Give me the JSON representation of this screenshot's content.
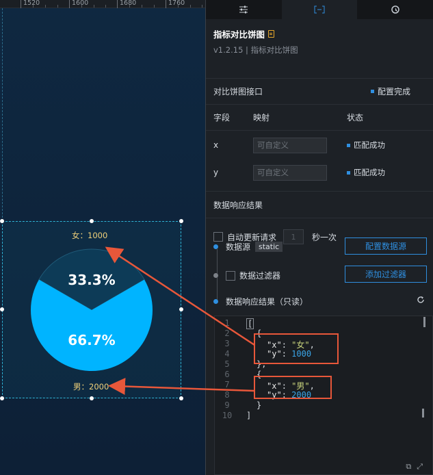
{
  "ruler": {
    "labels": [
      "1520",
      "1600",
      "1680",
      "1760"
    ]
  },
  "widget": {
    "top_label": "女：1000",
    "bottom_label": "男：2000",
    "pct_small": "33.3%",
    "pct_large": "66.7%",
    "colors": {
      "large_slice": "#00b4ff",
      "small_slice": "#0d3b57",
      "label": "#f2d27a"
    }
  },
  "chart_data": {
    "type": "pie",
    "categories": [
      "女",
      "男"
    ],
    "values": [
      1000,
      2000
    ]
  },
  "panel": {
    "tabs": [
      "settings-sliders-icon",
      "data-bracket-icon",
      "interaction-icon"
    ],
    "title": "指标对比饼图",
    "subtitle": "v1.2.15 | 指标对比饼图",
    "interface_label": "对比饼图接口",
    "config_done": "配置完成",
    "field_headers": {
      "field": "字段",
      "mapping": "映射",
      "status": "状态"
    },
    "fields": [
      {
        "name": "x",
        "placeholder": "可自定义",
        "status": "匹配成功"
      },
      {
        "name": "y",
        "placeholder": "可自定义",
        "status": "匹配成功"
      }
    ],
    "response_title": "数据响应结果",
    "auto_update": "自动更新请求",
    "interval_value": "1",
    "interval_unit": "秒一次",
    "datasource_label": "数据源",
    "datasource_tag": "static",
    "config_source_btn": "配置数据源",
    "filter_label": "数据过滤器",
    "add_filter_btn": "添加过滤器",
    "response_readonly": "数据响应结果（只读）",
    "code_lines": [
      "1",
      "2",
      "3",
      "4",
      "5",
      "6",
      "7",
      "8",
      "9",
      "10"
    ]
  },
  "code": {
    "open": "[",
    "brace_open": "{",
    "x_key": "\"x\"",
    "x1": "\"女\"",
    "y_key": "\"y\"",
    "y1": "1000",
    "brace_close_comma": "},",
    "x2": "\"男\"",
    "y2": "2000",
    "brace_close": "}",
    "close": "]"
  },
  "colors": {
    "accent": "#2f8fe0",
    "highlight_box": "#e8573a"
  }
}
